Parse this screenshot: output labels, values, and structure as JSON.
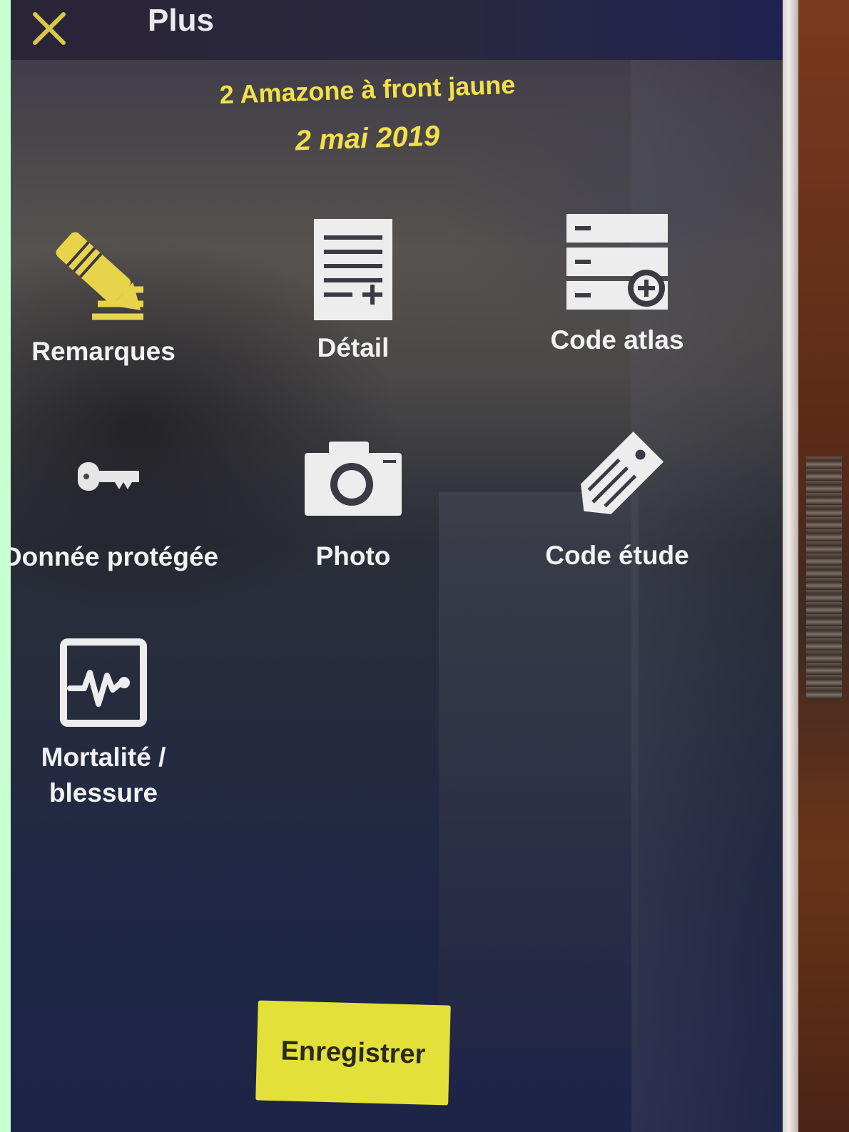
{
  "topbar": {
    "title": "Plus",
    "close_icon": "close-icon"
  },
  "observation": {
    "species_line": "2 Amazone à front jaune",
    "date": "2 mai 2019"
  },
  "actions": [
    {
      "label": "Remarques",
      "icon": "pencil-notes-icon"
    },
    {
      "label": "Détail",
      "icon": "document-add-icon"
    },
    {
      "label": "Code atlas",
      "icon": "list-add-icon"
    },
    {
      "label": "Donnée protégée",
      "icon": "key-icon"
    },
    {
      "label": "Photo",
      "icon": "camera-icon"
    },
    {
      "label": "Code étude",
      "icon": "tag-icon"
    },
    {
      "label": "Mortalité /",
      "label_line2": "blessure",
      "icon": "heartbeat-icon"
    }
  ],
  "save": {
    "label": "Enregistrer"
  },
  "colors": {
    "accent_yellow": "#f2e04a",
    "button_yellow": "#e3e03a",
    "label_white": "#f2f2f2",
    "screen_dark": "#1d2448"
  }
}
